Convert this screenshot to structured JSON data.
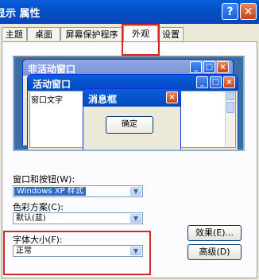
{
  "window": {
    "title": "显示 属性",
    "help_label": "?",
    "close_label": "✕"
  },
  "tabs": [
    "主题",
    "桌面",
    "屏幕保护程序",
    "外观",
    "设置"
  ],
  "active_tab_index": 3,
  "preview": {
    "inactive_title": "非活动窗口",
    "active_title": "活动窗口",
    "window_text": "窗口文字",
    "message_title": "消息框",
    "ok_label": "确定"
  },
  "fields": {
    "windows_buttons_label": "窗口和按钮(W):",
    "windows_buttons_value": "Windows XP 样式",
    "color_scheme_label": "色彩方案(C):",
    "color_scheme_value": "默认(蓝)",
    "font_size_label": "字体大小(F):",
    "font_size_value": "正常"
  },
  "buttons": {
    "effects": "效果(E)...",
    "advanced": "高级(D)"
  },
  "colors": {
    "highlight": "#D4282A",
    "title_bar": "#0A5FD9"
  }
}
